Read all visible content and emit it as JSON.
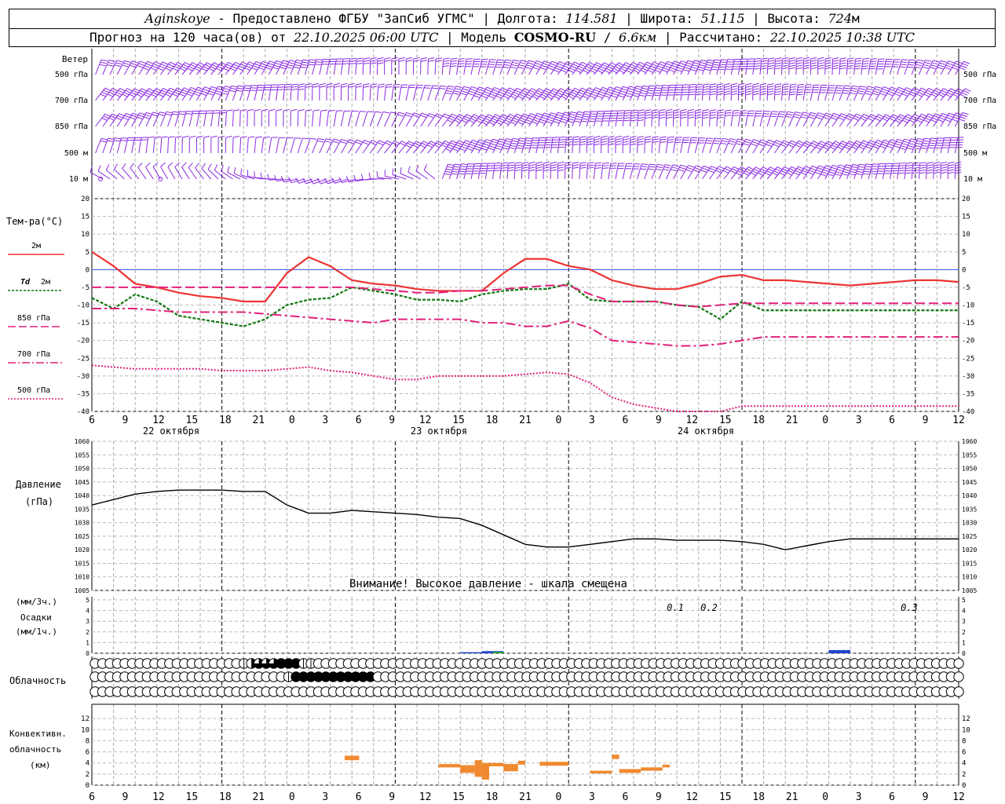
{
  "header": {
    "station": "Aginskoye",
    "provider": "Предоставлено ФГБУ \"ЗапСиб УГМС\"",
    "lon_label": "Долгота:",
    "lon": "114.581",
    "lat_label": "Широта:",
    "lat": "51.115",
    "alt_label": "Высота:",
    "alt": "724",
    "alt_unit": "м",
    "forecast_prefix": "Прогноз на 120 часа(ов) от",
    "forecast_time": "22.10.2025 06:00 UTC",
    "model_label": "Модель",
    "model": "COSMO-RU",
    "model_res": "6.6км",
    "calc_label": "Рассчитано:",
    "calc_time": "22.10.2025 10:38 UTC"
  },
  "labels": {
    "wind": "Ветер",
    "wind_levels": [
      "500 гПа",
      "700 гПа",
      "850 гПа",
      "500 м",
      "10  м"
    ],
    "temp": "Тем-ра(°С)",
    "t2m": "2м",
    "td": "Td",
    "td2m": "2м",
    "t850": "850 гПа",
    "t700": "700 гПа",
    "t500": "500 гПа",
    "pressure": "Давление",
    "pressure_unit": "(гПа)",
    "warning": "Внимание! Высокое давление - шкала смещена",
    "precip_3h": "(мм/3ч.)",
    "precip": "Осадки",
    "precip_1h": "(мм/1ч.)",
    "cloud": "Облачность",
    "conv1": "Конвективн.",
    "conv2": "облачность",
    "conv3": "(км)",
    "precip_notes": [
      "0.1",
      "0.2",
      "0.3"
    ]
  },
  "time_axis": {
    "hour_ticks": [
      "6",
      "9",
      "12",
      "15",
      "18",
      "21",
      "0",
      "3",
      "6",
      "9",
      "12",
      "15",
      "18",
      "21",
      "0",
      "3",
      "6",
      "9",
      "12",
      "15",
      "18",
      "21",
      "0",
      "3",
      "6",
      "9",
      "12"
    ],
    "dates": [
      "22 октября",
      "23 октября",
      "24 октября"
    ]
  },
  "colors": {
    "wind": "#8a2be2",
    "t2m": "#ee3333",
    "td": "#117711",
    "t850": "#e0207a",
    "t700": "#e0207a",
    "t500": "#e0207a",
    "zero": "#3355ff",
    "pressure": "#000000",
    "precip_blue": "#2244cc",
    "precip_green": "#22aa22",
    "conv": "#f08a30"
  },
  "chart_data": [
    {
      "type": "line",
      "title": "Тем-ра(°С)",
      "x_hours": [
        0,
        3,
        6,
        9,
        12,
        15,
        18,
        21,
        24,
        27,
        30,
        33,
        36,
        39,
        42,
        45,
        48,
        51,
        54,
        57,
        60,
        63,
        66,
        69,
        72,
        75,
        78,
        81,
        84,
        87,
        90,
        93,
        96,
        99,
        102,
        105,
        108,
        111,
        114,
        117,
        120
      ],
      "ylim": [
        -40,
        20
      ],
      "series": [
        {
          "name": "2м",
          "values": [
            5,
            1,
            -4,
            -5,
            -6.5,
            -7.5,
            -8,
            -9,
            -9,
            -1,
            3.5,
            1,
            -3,
            -4,
            -4.5,
            -5.5,
            -6,
            -6,
            -6,
            -1,
            3,
            3,
            1,
            0,
            -3,
            -4.5,
            -5.5,
            -5.5,
            -4,
            -2,
            -1.5,
            -3,
            -3,
            -3.5,
            -4,
            -4.5,
            -4,
            -3.5,
            -3,
            -3,
            -3.5
          ]
        },
        {
          "name": "Td 2м",
          "values": [
            -8,
            -11,
            -7,
            -9,
            -13,
            -14,
            -15,
            -16,
            -14,
            -10,
            -8.5,
            -8,
            -5,
            -6,
            -7,
            -8.5,
            -8.5,
            -9,
            -7,
            -6,
            -5.5,
            -5.5,
            -4,
            -8.5,
            -9,
            -9,
            -9,
            -10,
            -10.5,
            -14,
            -9,
            -11.5,
            -11.5,
            -11.5,
            -11.5,
            -11.5,
            -11.5,
            -11.5,
            -11.5,
            -11.5,
            -11.5
          ]
        },
        {
          "name": "850 гПа",
          "values": [
            -5,
            -5,
            -5,
            -5,
            -5,
            -5,
            -5,
            -5,
            -5,
            -5,
            -5,
            -5,
            -5,
            -5.5,
            -6,
            -6.5,
            -6.5,
            -6,
            -6,
            -5.5,
            -5,
            -4.5,
            -4.5,
            -7,
            -9,
            -9,
            -9,
            -10,
            -10.5,
            -10,
            -9.5,
            -9.5,
            -9.5,
            -9.5,
            -9.5,
            -9.5,
            -9.5,
            -9.5,
            -9.5,
            -9.5,
            -9.5
          ]
        },
        {
          "name": "700 гПа",
          "values": [
            -11,
            -11,
            -11,
            -11.5,
            -12,
            -12,
            -12,
            -12,
            -12.5,
            -13,
            -13.5,
            -14,
            -14.5,
            -15,
            -14,
            -14,
            -14,
            -14,
            -15,
            -15,
            -16,
            -16,
            -14.5,
            -16.5,
            -20,
            -20.5,
            -21,
            -21.5,
            -21.5,
            -21,
            -20,
            -19,
            -19,
            -19,
            -19,
            -19,
            -19,
            -19,
            -19,
            -19,
            -19
          ]
        },
        {
          "name": "500 гПа",
          "values": [
            -27,
            -27.5,
            -28,
            -28,
            -28,
            -28,
            -28.5,
            -28.5,
            -28.5,
            -28,
            -27.5,
            -28.5,
            -29,
            -30,
            -31,
            -31,
            -30,
            -30,
            -30,
            -30,
            -29.5,
            -29,
            -29.5,
            -32,
            -36,
            -38,
            -39,
            -40,
            -41,
            -40,
            -38.5,
            -38.5,
            -38.5,
            -38.5,
            -38.5,
            -38.5,
            -38.5,
            -38.5,
            -38.5,
            -38.5,
            -38.5
          ]
        }
      ]
    },
    {
      "type": "line",
      "title": "Давление",
      "x_hours": [
        0,
        3,
        6,
        9,
        12,
        15,
        18,
        21,
        24,
        27,
        30,
        33,
        36,
        39,
        42,
        45,
        48,
        51,
        54,
        57,
        60,
        63,
        66,
        69,
        72,
        75,
        78,
        81,
        84,
        87,
        90,
        93,
        96,
        99,
        102,
        105,
        108,
        111,
        114,
        117,
        120
      ],
      "ylim": [
        1005,
        1060
      ],
      "series": [
        {
          "name": "Давление",
          "values": [
            1036.5,
            1038.5,
            1040.5,
            1041.5,
            1042,
            1042,
            1042,
            1041.5,
            1041.5,
            1036.5,
            1033.5,
            1033.5,
            1034.5,
            1034,
            1033.5,
            1033,
            1032,
            1031.5,
            1029,
            1025.5,
            1022,
            1021,
            1021,
            1022,
            1023,
            1024,
            1024,
            1023.5,
            1023.5,
            1023.5,
            1023,
            1022,
            1020,
            1021.5,
            1023,
            1024,
            1024,
            1024,
            1024,
            1024,
            1024
          ]
        }
      ]
    },
    {
      "type": "bar",
      "title": "Осадки",
      "ylim": [
        0,
        5
      ],
      "series": [
        {
          "name": "мм/3ч.",
          "bars": [
            {
              "x0": 51,
              "x1": 55,
              "v": 0.1
            },
            {
              "x0": 54,
              "x1": 57,
              "v": 0.2
            },
            {
              "x0": 102,
              "x1": 105,
              "v": 0.3
            }
          ]
        }
      ]
    },
    {
      "type": "bar",
      "title": "Конвективн. облачность",
      "ylim": [
        0,
        14
      ],
      "series": [
        {
          "name": "км",
          "bars": [
            {
              "x0": 35,
              "x1": 37,
              "lo": 4.5,
              "hi": 5.3
            },
            {
              "x0": 48,
              "x1": 51,
              "lo": 3.2,
              "hi": 3.8
            },
            {
              "x0": 51,
              "x1": 53,
              "lo": 2.2,
              "hi": 3.6
            },
            {
              "x0": 53,
              "x1": 54,
              "lo": 1.5,
              "hi": 4.5
            },
            {
              "x0": 54,
              "x1": 55,
              "lo": 1,
              "hi": 4
            },
            {
              "x0": 55,
              "x1": 57,
              "lo": 3.4,
              "hi": 4
            },
            {
              "x0": 57,
              "x1": 59,
              "lo": 2.5,
              "hi": 3.8
            },
            {
              "x0": 59,
              "x1": 60,
              "lo": 3.7,
              "hi": 4.4
            },
            {
              "x0": 62,
              "x1": 66,
              "lo": 3.5,
              "hi": 4.2
            },
            {
              "x0": 69,
              "x1": 72,
              "lo": 2.1,
              "hi": 2.6
            },
            {
              "x0": 72,
              "x1": 73,
              "lo": 4.7,
              "hi": 5.5
            },
            {
              "x0": 73,
              "x1": 76,
              "lo": 2.2,
              "hi": 2.9
            },
            {
              "x0": 76,
              "x1": 79,
              "lo": 2.6,
              "hi": 3.2
            },
            {
              "x0": 79,
              "x1": 80,
              "lo": 3.2,
              "hi": 3.7
            }
          ]
        }
      ]
    }
  ],
  "cloud_rows": {
    "high": "000000000000000000001233344411000000000000000000000000000000000000000000000000000000000000000000000000000000000000000",
    "mid": "000000000000000000000000001444444444440000000000000000000000000000000000000000000000000000000000000000000000000000000",
    "low": "000000000000000000000000000000000000000000000000000000000000000000000000000000000000000000000000000000000000000000000"
  }
}
